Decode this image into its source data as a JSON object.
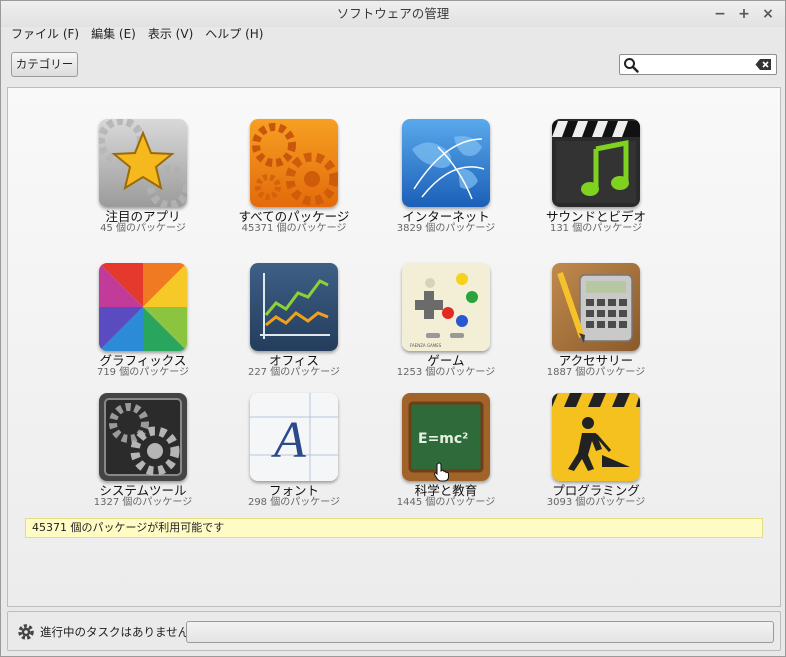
{
  "window": {
    "title": "ソフトウェアの管理",
    "controls": {
      "minimize": "−",
      "maximize": "+",
      "close": "×"
    }
  },
  "menubar": [
    {
      "label": "ファイル (F)"
    },
    {
      "label": "編集 (E)"
    },
    {
      "label": "表示 (V)"
    },
    {
      "label": "ヘルプ (H)"
    }
  ],
  "toolbar": {
    "categories_label": "カテゴリー",
    "search": {
      "value": "",
      "placeholder": ""
    }
  },
  "categories": [
    {
      "label": "注目のアプリ",
      "count": "45 個のパッケージ",
      "icon": "star-gear-icon"
    },
    {
      "label": "すべてのパッケージ",
      "count": "45371 個のパッケージ",
      "icon": "orange-gears-icon"
    },
    {
      "label": "インターネット",
      "count": "3829 個のパッケージ",
      "icon": "globe-network-icon"
    },
    {
      "label": "サウンドとビデオ",
      "count": "131 個のパッケージ",
      "icon": "clapperboard-music-icon"
    },
    {
      "label": "グラフィックス",
      "count": "719 個のパッケージ",
      "icon": "color-wheel-icon"
    },
    {
      "label": "オフィス",
      "count": "227 個のパッケージ",
      "icon": "chart-icon"
    },
    {
      "label": "ゲーム",
      "count": "1253 個のパッケージ",
      "icon": "gamepad-icon"
    },
    {
      "label": "アクセサリー",
      "count": "1887 個のパッケージ",
      "icon": "calculator-icon"
    },
    {
      "label": "システムツール",
      "count": "1327 個のパッケージ",
      "icon": "system-gears-icon"
    },
    {
      "label": "フォント",
      "count": "298 個のパッケージ",
      "icon": "font-icon"
    },
    {
      "label": "科学と教育",
      "count": "1445 個のパッケージ",
      "icon": "chalkboard-icon"
    },
    {
      "label": "プログラミング",
      "count": "3093 個のパッケージ",
      "icon": "construction-icon"
    }
  ],
  "icon_text": {
    "font_letter": "A",
    "formula": "E=mc²",
    "board_caption": "FAENZA GAMES"
  },
  "info_bar": {
    "text": "45371 個のパッケージが利用可能です"
  },
  "statusbar": {
    "text": "進行中のタスクはありません"
  }
}
